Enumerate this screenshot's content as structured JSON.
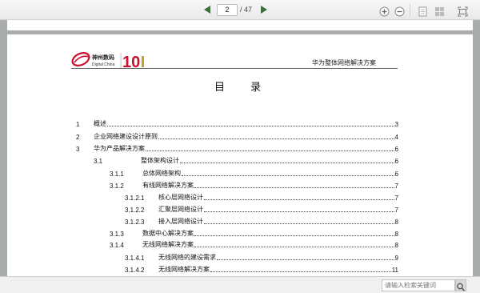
{
  "toolbar": {
    "current_page": "2",
    "total_pages": "/ 47",
    "icons": [
      "prev-page-icon",
      "next-page-icon",
      "zoom-in-icon",
      "zoom-out-icon",
      "single-page-icon",
      "multi-page-icon",
      "fullscreen-icon"
    ]
  },
  "document": {
    "logo_cn": "神州数码",
    "logo_en": "Digital China",
    "logo_badge": "10",
    "header_title": "华为整体网络解决方案",
    "toc_title": "目 录",
    "toc": [
      {
        "num": "1",
        "text": "概述",
        "page": "3"
      },
      {
        "num": "2",
        "text": "企业网络建设设计原则",
        "page": "4"
      },
      {
        "num": "3",
        "text": "华为产品解决方案",
        "page": "6"
      },
      {
        "num": "3.1",
        "text": "整体架构设计",
        "page": "6"
      },
      {
        "num": "3.1.1",
        "text": "总体网络架构",
        "page": "6"
      },
      {
        "num": "3.1.2",
        "text": "有线网络解决方案",
        "page": "7"
      },
      {
        "num": "3.1.2.1",
        "text": "核心层网络设计",
        "page": "7"
      },
      {
        "num": "3.1.2.2",
        "text": "汇聚层网络设计",
        "page": "7"
      },
      {
        "num": "3.1.2.3",
        "text": "接入层网络设计",
        "page": "8"
      },
      {
        "num": "3.1.3",
        "text": "数据中心解决方案",
        "page": "8"
      },
      {
        "num": "3.1.4",
        "text": "无线网络解决方案",
        "page": "8"
      },
      {
        "num": "3.1.4.1",
        "text": "无线网络的建设需求",
        "page": "9"
      },
      {
        "num": "3.1.4.2",
        "text": "无线网络解决方案",
        "page": "11"
      }
    ]
  },
  "statusbar": {
    "search_placeholder": "请输入检索关键词"
  },
  "colors": {
    "nav_arrow": "#3c6e3c",
    "viewer_bg": "#a9ada9",
    "logo_red": "#c8102e",
    "logo_gold": "#c9a227"
  }
}
